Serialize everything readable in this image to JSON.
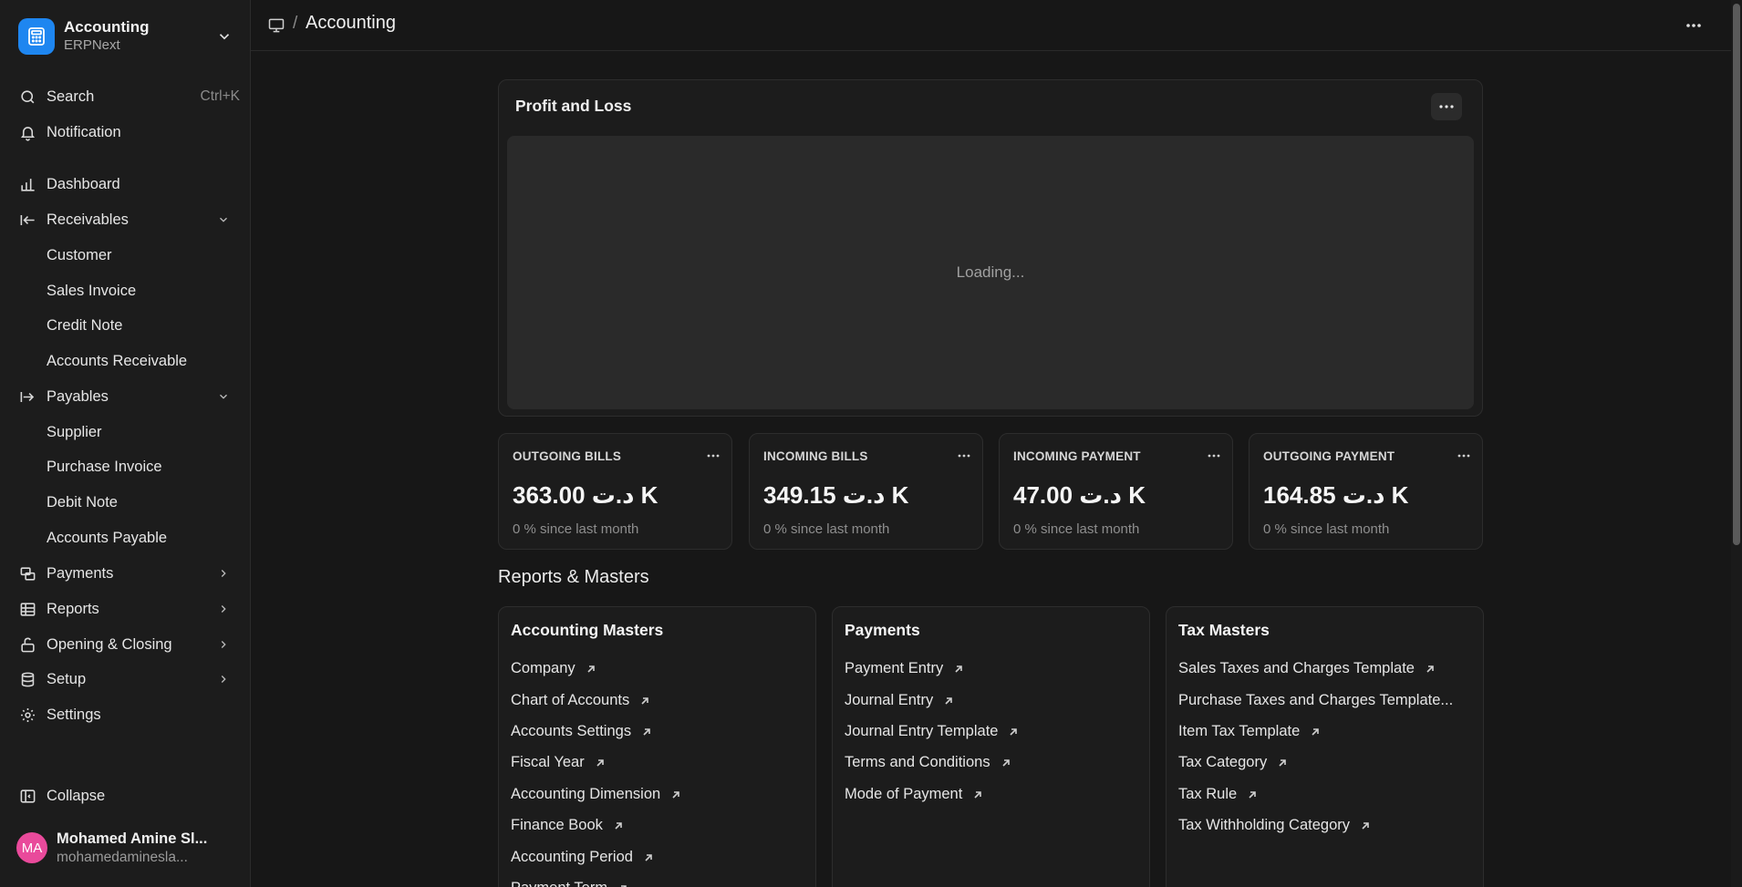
{
  "app": {
    "title": "Accounting",
    "subtitle": "ERPNext",
    "logo_color": "#1e86f0"
  },
  "sidebar": {
    "search": {
      "label": "Search",
      "shortcut": "Ctrl+K"
    },
    "notification": {
      "label": "Notification"
    },
    "items": [
      {
        "label": "Dashboard",
        "icon": "bar-chart-icon"
      },
      {
        "label": "Receivables",
        "icon": "arrow-left-bar-icon",
        "expanded": true
      },
      {
        "label": "Customer"
      },
      {
        "label": "Sales Invoice"
      },
      {
        "label": "Credit Note"
      },
      {
        "label": "Accounts Receivable"
      },
      {
        "label": "Payables",
        "icon": "arrow-right-bar-icon",
        "expanded": true
      },
      {
        "label": "Supplier"
      },
      {
        "label": "Purchase Invoice"
      },
      {
        "label": "Debit Note"
      },
      {
        "label": "Accounts Payable"
      },
      {
        "label": "Payments",
        "icon": "payments-icon"
      },
      {
        "label": "Reports",
        "icon": "table-icon"
      },
      {
        "label": "Opening & Closing",
        "icon": "lock-open-icon"
      },
      {
        "label": "Setup",
        "icon": "database-icon"
      },
      {
        "label": "Settings",
        "icon": "gear-icon"
      }
    ],
    "collapse_label": "Collapse"
  },
  "user": {
    "initials": "MA",
    "name": "Mohamed Amine Sl...",
    "email": "mohamedamineslа...",
    "avatar_color": "#e94a9b"
  },
  "header": {
    "separator": "/",
    "title": "Accounting"
  },
  "profit_loss": {
    "title": "Profit and Loss",
    "loading_text": "Loading..."
  },
  "number_cards": [
    {
      "label": "OUTGOING BILLS",
      "value": "363.00 د.ت K",
      "stat": "0 % since last month"
    },
    {
      "label": "INCOMING BILLS",
      "value": "349.15 د.ت K",
      "stat": "0 % since last month"
    },
    {
      "label": "INCOMING PAYMENT",
      "value": "47.00 د.ت K",
      "stat": "0 % since last month"
    },
    {
      "label": "OUTGOING PAYMENT",
      "value": "164.85 د.ت K",
      "stat": "0 % since last month"
    }
  ],
  "reports_section": {
    "title": "Reports & Masters",
    "cards": [
      {
        "title": "Accounting Masters",
        "links": [
          "Company",
          "Chart of Accounts",
          "Accounts Settings",
          "Fiscal Year",
          "Accounting Dimension",
          "Finance Book",
          "Accounting Period",
          "Payment Term"
        ]
      },
      {
        "title": "Payments",
        "links": [
          "Payment Entry",
          "Journal Entry",
          "Journal Entry Template",
          "Terms and Conditions",
          "Mode of Payment"
        ]
      },
      {
        "title": "Tax Masters",
        "links": [
          "Sales Taxes and Charges Template",
          "Purchase Taxes and Charges Template...",
          "Item Tax Template",
          "Tax Category",
          "Tax Rule",
          "Tax Withholding Category"
        ]
      }
    ]
  }
}
